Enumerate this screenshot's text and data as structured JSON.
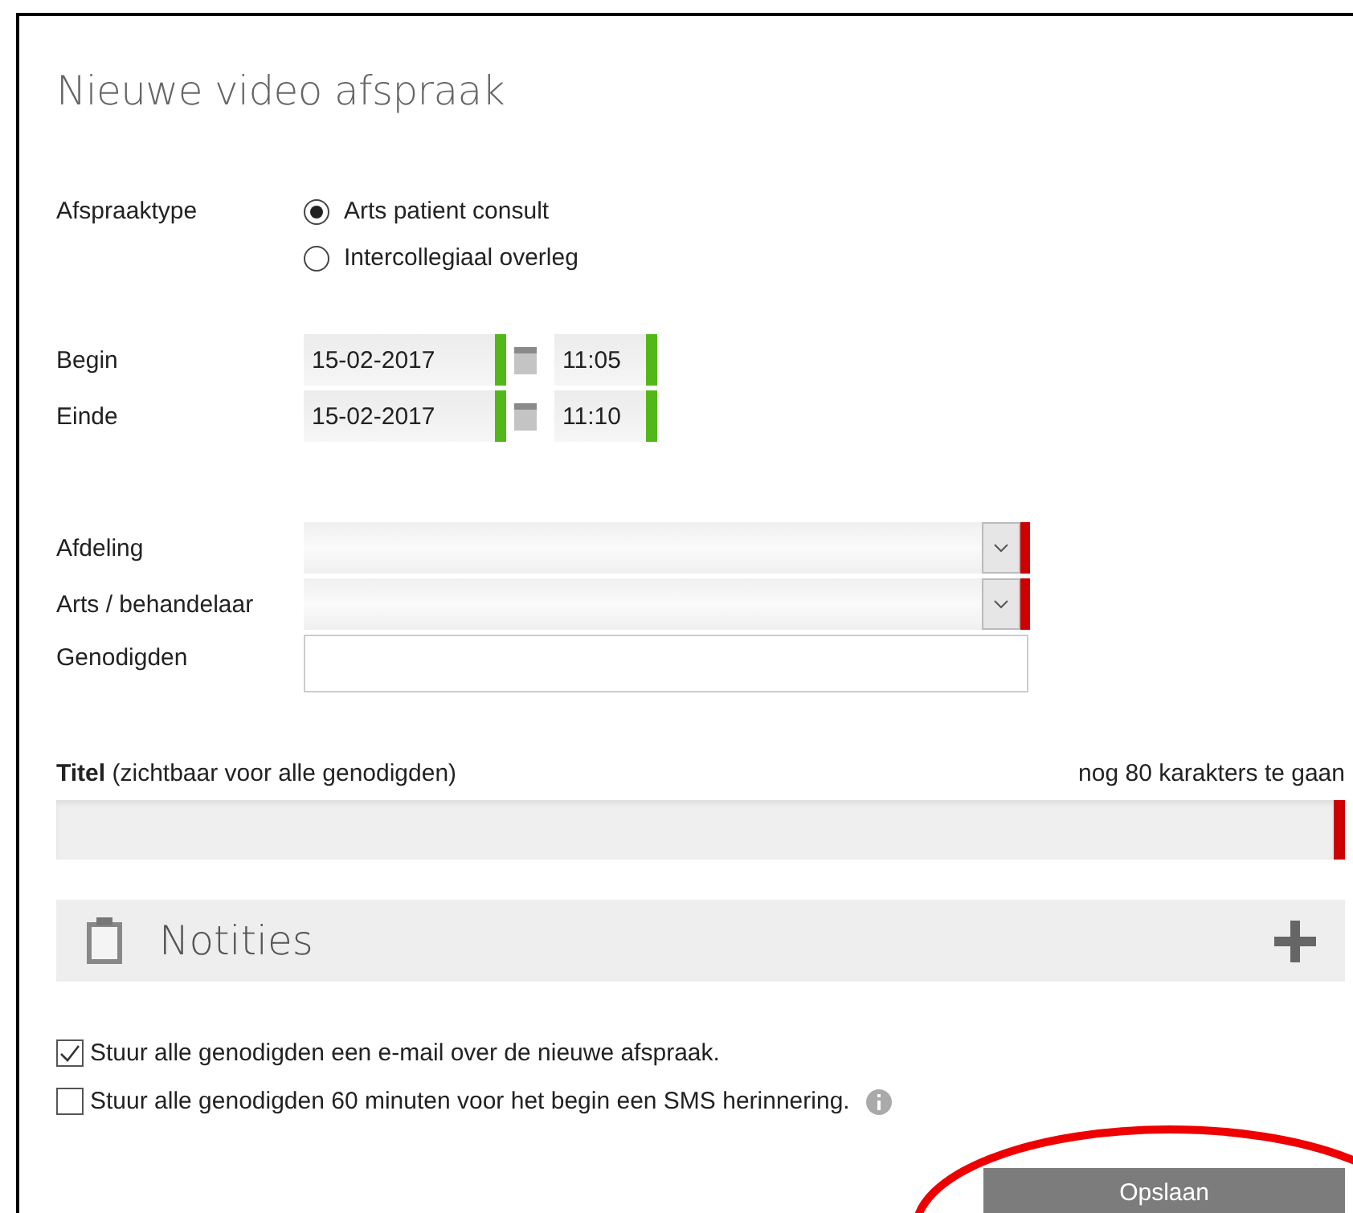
{
  "dialog": {
    "title": "Nieuwe video afspraak"
  },
  "appointment_type": {
    "label": "Afspraaktype",
    "options": [
      {
        "label": "Arts patient consult",
        "selected": true
      },
      {
        "label": "Intercollegiaal overleg",
        "selected": false
      }
    ]
  },
  "times": [
    {
      "label": "Begin",
      "date": "15-02-2017",
      "time": "11:05",
      "valid": true
    },
    {
      "label": "Einde",
      "date": "15-02-2017",
      "time": "11:10",
      "valid": true
    }
  ],
  "fields": [
    {
      "label": "Afdeling",
      "kind": "select",
      "valid": false
    },
    {
      "label": "Arts / behandelaar",
      "kind": "select",
      "valid": false
    },
    {
      "label": "Genodigden",
      "kind": "text"
    }
  ],
  "title_field": {
    "label": "**Titel** (zichtbaar voor alle genodigden)",
    "counter": "nog 80 karakters te gaan",
    "valid": false
  },
  "notes": {
    "label": "Notities",
    "expanded": false
  },
  "notifications": [
    {
      "label": "Stuur alle genodigden een e-mail over de nieuwe afspraak.",
      "checked": true,
      "info": false
    },
    {
      "label": "Stuur alle genodigden 60 minuten voor het begin een SMS herinnering.",
      "checked": false,
      "info": true
    }
  ],
  "save_button": {
    "label": "Opslaan"
  },
  "annotation": {
    "kind": "ellipse"
  }
}
